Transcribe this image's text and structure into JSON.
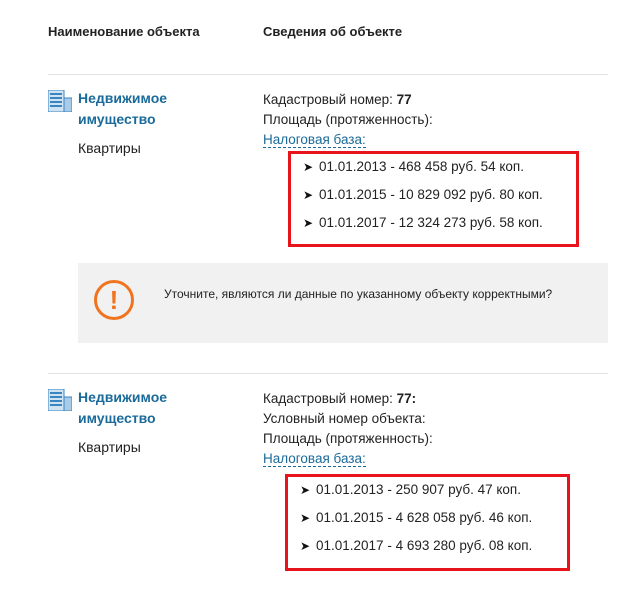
{
  "table": {
    "col_name_header": "Наименование объекта",
    "col_info_header": "Сведения об объекте"
  },
  "objects": [
    {
      "title": "Недвижимое имущество",
      "kind": "Квартиры",
      "cadastral_label": "Кадастровый номер:",
      "cadastral_value": "77",
      "conditional_label": "",
      "area_label": "Площадь (протяженность):",
      "tax_base_link": "Налоговая база:",
      "tax_base": [
        "01.01.2013 - 468 458 руб. 54 коп.",
        "01.01.2015 - 10 829 092 руб. 80 коп.",
        "01.01.2017 - 12 324 273 руб. 58 коп."
      ]
    },
    {
      "title": "Недвижимое имущество",
      "kind": "Квартиры",
      "cadastral_label": "Кадастровый номер:",
      "cadastral_value": "77:",
      "conditional_label": "Условный номер объекта:",
      "area_label": "Площадь (протяженность):",
      "tax_base_link": "Налоговая база:",
      "tax_base": [
        "01.01.2013 - 250 907 руб. 47 коп.",
        "01.01.2015 - 4 628 058 руб. 46 коп.",
        "01.01.2017 - 4 693 280 руб. 08 коп."
      ]
    }
  ],
  "alert": {
    "icon": "exclamation-circle-icon",
    "icon_glyph": "!",
    "message": "Уточните, являются ли данные по указанному объекту корректными?",
    "accent_color": "#f0741f"
  },
  "colors": {
    "link": "#1a6a9a",
    "highlight_box": "#e8141c",
    "alert_bg": "#f1f1f1"
  }
}
